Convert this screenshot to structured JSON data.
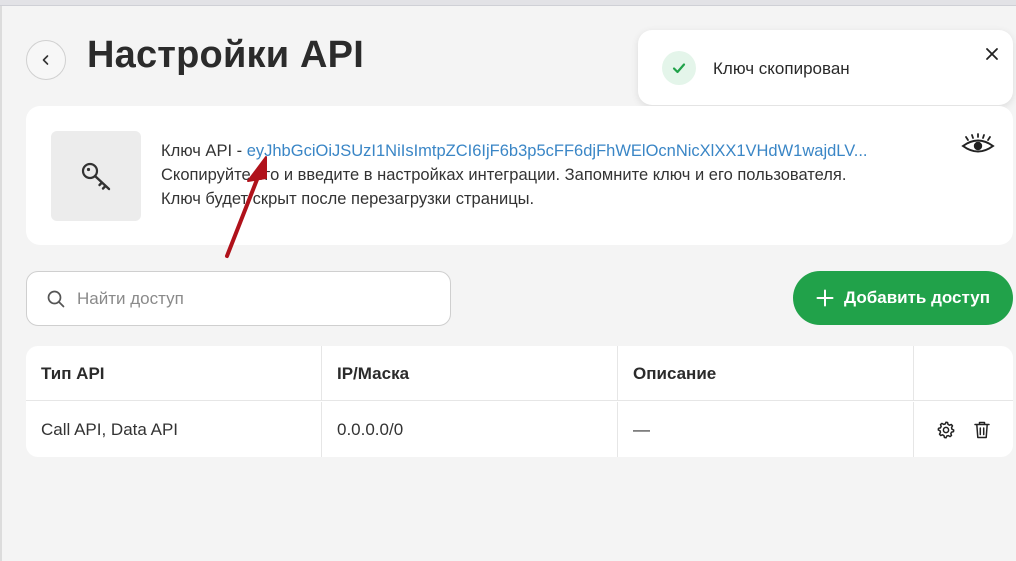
{
  "header": {
    "title": "Настройки API",
    "back_icon": "chevron-left-icon"
  },
  "toast": {
    "message": "Ключ скопирован",
    "icon": "check-icon",
    "close_icon": "close-icon",
    "accent": "#21a24a"
  },
  "key_card": {
    "label": "Ключ API - ",
    "value": "eyJhbGciOiJSUzI1NiIsImtpZCI6IjF6b3p5cFF6djFhWElOcnNicXlXX1VHdW1wajdLV...",
    "instruction": "Скопируйте его и введите в настройках интеграции. Запомните ключ и его пользователя.",
    "note": "Ключ будет скрыт после перезагрузки страницы.",
    "tile_icon": "key-icon",
    "visibility_icon": "eye-icon",
    "link_color": "#3a86c6"
  },
  "search": {
    "placeholder": "Найти доступ",
    "value": ""
  },
  "add_button": {
    "label": "Добавить доступ",
    "icon": "plus-icon",
    "color": "#21a24a"
  },
  "table": {
    "columns": [
      "Тип API",
      "IP/Маска",
      "Описание",
      ""
    ],
    "rows": [
      {
        "type": "Call API, Data API",
        "ip": "0.0.0.0/0",
        "description": "—"
      }
    ],
    "row_actions": [
      "gear-icon",
      "trash-icon"
    ]
  },
  "annotation": {
    "arrow_color": "#b0121b"
  }
}
